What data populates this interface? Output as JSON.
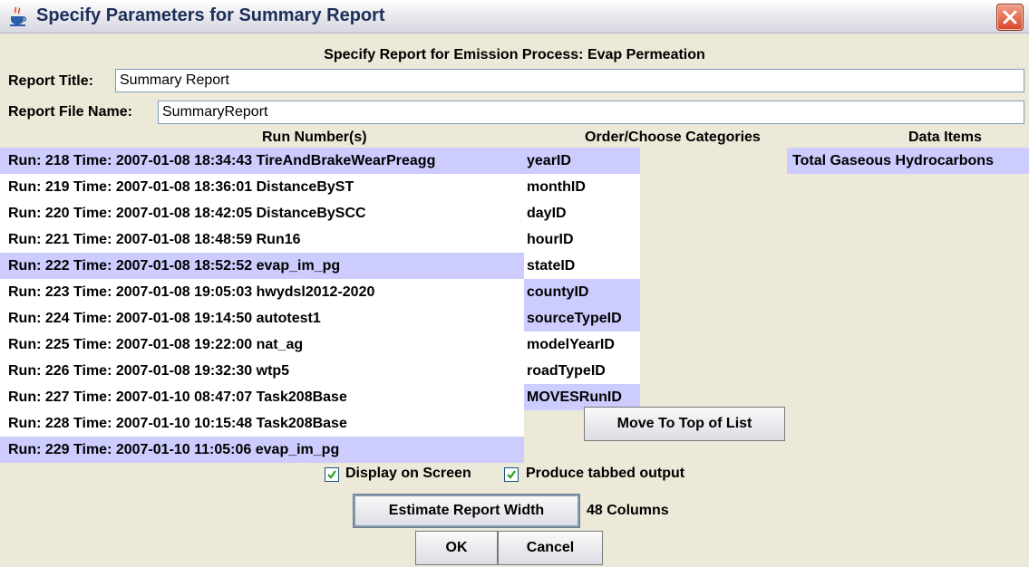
{
  "window": {
    "title": "Specify Parameters for Summary Report",
    "icon": "java-icon",
    "close_icon": "close-icon"
  },
  "heading": "Specify Report for Emission Process: Evap Permeation",
  "report_title": {
    "label": "Report Title:",
    "value": "Summary Report"
  },
  "report_file": {
    "label": "Report File Name:",
    "value": "SummaryReport"
  },
  "columns": {
    "runs": "Run Number(s)",
    "categories": "Order/Choose Categories",
    "data_items": "Data Items"
  },
  "runs": [
    {
      "text": "Run: 218 Time: 2007-01-08 18:34:43 TireAndBrakeWearPreagg",
      "selected": true
    },
    {
      "text": "Run: 219 Time: 2007-01-08 18:36:01 DistanceByST",
      "selected": false
    },
    {
      "text": "Run: 220 Time: 2007-01-08 18:42:05 DistanceBySCC",
      "selected": false
    },
    {
      "text": "Run: 221 Time: 2007-01-08 18:48:59 Run16",
      "selected": false
    },
    {
      "text": "Run: 222 Time: 2007-01-08 18:52:52 evap_im_pg",
      "selected": true
    },
    {
      "text": "Run: 223 Time: 2007-01-08 19:05:03 hwydsl2012-2020",
      "selected": false
    },
    {
      "text": "Run: 224 Time: 2007-01-08 19:14:50 autotest1",
      "selected": false
    },
    {
      "text": "Run: 225 Time: 2007-01-08 19:22:00 nat_ag",
      "selected": false
    },
    {
      "text": "Run: 226 Time: 2007-01-08 19:32:30 wtp5",
      "selected": false
    },
    {
      "text": "Run: 227 Time: 2007-01-10 08:47:07 Task208Base",
      "selected": false
    },
    {
      "text": "Run: 228 Time: 2007-01-10 10:15:48 Task208Base",
      "selected": false
    },
    {
      "text": "Run: 229 Time: 2007-01-10 11:05:06 evap_im_pg",
      "selected": true
    }
  ],
  "categories": [
    {
      "text": "yearID",
      "selected": true
    },
    {
      "text": "monthID",
      "selected": false
    },
    {
      "text": "dayID",
      "selected": false
    },
    {
      "text": "hourID",
      "selected": false
    },
    {
      "text": "stateID",
      "selected": false
    },
    {
      "text": "countyID",
      "selected": true
    },
    {
      "text": "sourceTypeID",
      "selected": true
    },
    {
      "text": "modelYearID",
      "selected": false
    },
    {
      "text": "roadTypeID",
      "selected": false
    },
    {
      "text": "MOVESRunID",
      "selected": true
    }
  ],
  "data_items": [
    {
      "text": "Total Gaseous Hydrocarbons",
      "selected": true
    }
  ],
  "buttons": {
    "move_top": "Move To Top of List",
    "estimate": "Estimate Report Width",
    "ok": "OK",
    "cancel": "Cancel"
  },
  "options": {
    "display_on_screen": {
      "label": "Display on Screen",
      "checked": true
    },
    "tabbed_output": {
      "label": "Produce tabbed output",
      "checked": true
    }
  },
  "width_estimate": "48 Columns",
  "colors": {
    "selection": "#ccccff",
    "background": "#ece9d8",
    "field_border": "#7f9db9"
  }
}
